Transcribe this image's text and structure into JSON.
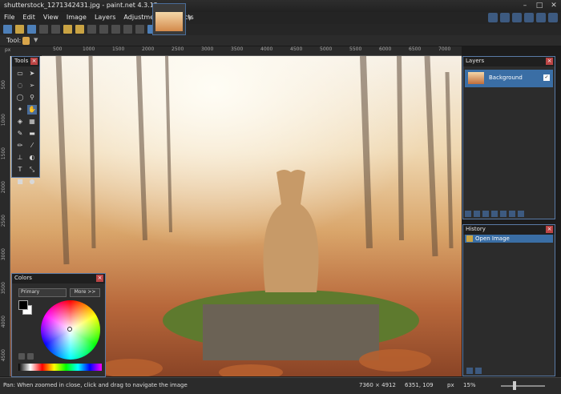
{
  "window": {
    "title": "shutterstock_1271342431.jpg - paint.net 4.3.12"
  },
  "menu": [
    "File",
    "Edit",
    "View",
    "Image",
    "Layers",
    "Adjustments",
    "Effects"
  ],
  "options": {
    "tool_label": "Tool:"
  },
  "rulers": {
    "unit": "px",
    "top_ticks": [
      "500",
      "1000",
      "1500",
      "2000",
      "2500",
      "3000",
      "3500",
      "4000",
      "4500",
      "5000",
      "5500",
      "6000",
      "6500",
      "7000"
    ],
    "left_ticks": [
      "500",
      "1000",
      "1500",
      "2000",
      "2500",
      "3000",
      "3500",
      "4000",
      "4500"
    ]
  },
  "panels": {
    "tools": {
      "title": "Tools"
    },
    "colors": {
      "title": "Colors",
      "select_value": "Primary",
      "more_label": "More >>"
    },
    "layers": {
      "title": "Layers",
      "layer_name": "Background"
    },
    "history": {
      "title": "History",
      "item": "Open Image"
    }
  },
  "status": {
    "hint": "Pan: When zoomed in close, click and drag to navigate the image",
    "image_size": "7360 × 4912",
    "cursor_pos": "6351, 109",
    "unit": "px",
    "zoom": "15%"
  }
}
